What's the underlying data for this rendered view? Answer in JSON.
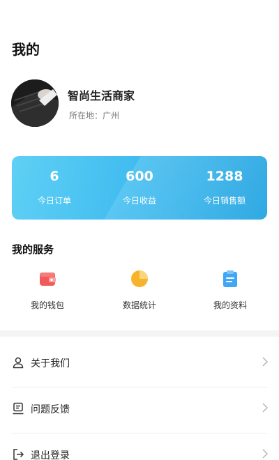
{
  "page": {
    "title": "我的"
  },
  "profile": {
    "name": "智尚生活商家",
    "location": "所在地：广州"
  },
  "stats": [
    {
      "value": "6",
      "label": "今日订单"
    },
    {
      "value": "600",
      "label": "今日收益"
    },
    {
      "value": "1288",
      "label": "今日销售额"
    }
  ],
  "services": {
    "title": "我的服务",
    "items": [
      {
        "label": "我的钱包",
        "icon": "wallet-icon",
        "color": "#f05a5a"
      },
      {
        "label": "数据统计",
        "icon": "pie-chart-icon",
        "color": "#f7b32b"
      },
      {
        "label": "我的资料",
        "icon": "clipboard-icon",
        "color": "#3fa7f5"
      }
    ]
  },
  "menu": [
    {
      "label": "关于我们",
      "icon": "user-icon"
    },
    {
      "label": "问题反馈",
      "icon": "feedback-icon"
    },
    {
      "label": "退出登录",
      "icon": "logout-icon"
    }
  ],
  "colors": {
    "accent": "#42bdf0",
    "card_gradient_start": "#5fd0f5",
    "card_gradient_end": "#29a6e2"
  }
}
